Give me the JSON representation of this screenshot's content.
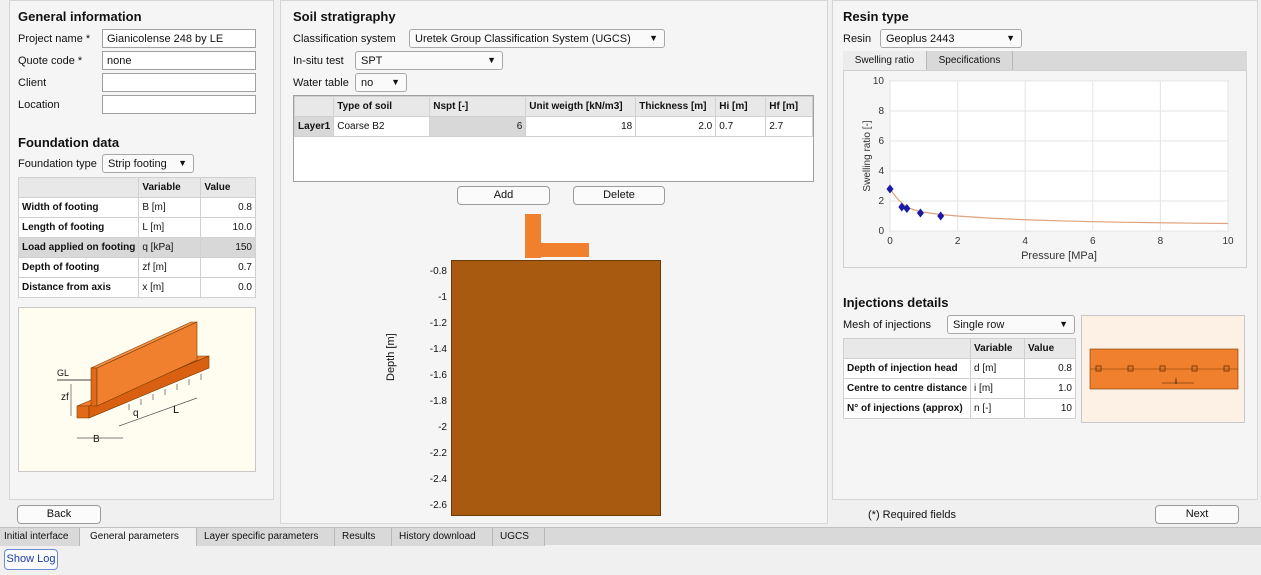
{
  "general": {
    "title": "General information",
    "project_label": "Project name *",
    "project_value": "Gianicolense 248 by LE",
    "quote_label": "Quote code *",
    "quote_value": "none",
    "client_label": "Client",
    "client_value": "",
    "location_label": "Location",
    "location_value": ""
  },
  "foundation": {
    "title": "Foundation data",
    "type_label": "Foundation type",
    "type_value": "Strip footing",
    "headers": [
      "",
      "Variable",
      "Value"
    ],
    "rows": [
      {
        "name": "Width of footing",
        "variable": "B [m]",
        "value": "0.8"
      },
      {
        "name": "Length of footing",
        "variable": "L [m]",
        "value": "10.0"
      },
      {
        "name": "Load applied on footing",
        "variable": "q [kPa]",
        "value": "150"
      },
      {
        "name": "Depth of footing",
        "variable": "zf [m]",
        "value": "0.7"
      },
      {
        "name": "Distance from axis",
        "variable": "x [m]",
        "value": "0.0"
      }
    ],
    "diagram_labels": {
      "gl": "GL",
      "zf": "zf",
      "q": "q",
      "l": "L",
      "b": "B"
    }
  },
  "soil": {
    "title": "Soil stratigraphy",
    "classification_label": "Classification system",
    "classification_value": "Uretek Group Classification System (UGCS)",
    "insitu_label": "In-situ test",
    "insitu_value": "SPT",
    "water_label": "Water table",
    "water_value": "no",
    "headers": [
      "",
      "Type of soil",
      "Nspt [-]",
      "Unit weigth [kN/m3]",
      "Thickness [m]",
      "Hi [m]",
      "Hf [m]"
    ],
    "layers": [
      {
        "layer": "Layer1",
        "type": "Coarse B2",
        "nspt": "6",
        "unit_weight": "18",
        "thickness": "2.0",
        "hi": "0.7",
        "hf": "2.7"
      }
    ],
    "add_label": "Add",
    "delete_label": "Delete",
    "depth_axis_label": "Depth [m]",
    "depth_ticks": [
      "-0.8",
      "-1",
      "-1.2",
      "-1.4",
      "-1.6",
      "-1.8",
      "-2",
      "-2.2",
      "-2.4",
      "-2.6"
    ]
  },
  "resin": {
    "title": "Resin type",
    "resin_label": "Resin",
    "resin_value": "Geoplus 2443",
    "tabs": [
      "Swelling ratio",
      "Specifications"
    ]
  },
  "chart_data": {
    "type": "scatter",
    "xlabel": "Pressure [MPa]",
    "ylabel": "Swelling ratio [-]",
    "xlim": [
      0,
      10
    ],
    "ylim": [
      0,
      10
    ],
    "xticks": [
      0,
      2,
      4,
      6,
      8,
      10
    ],
    "yticks": [
      0,
      2,
      4,
      6,
      8,
      10
    ],
    "grid": true,
    "points": {
      "x": [
        0.0,
        0.35,
        0.5,
        0.9,
        1.5
      ],
      "y": [
        2.8,
        1.6,
        1.5,
        1.2,
        1.0
      ]
    },
    "curve": {
      "x": [
        0.0,
        0.2,
        0.4,
        0.6,
        0.8,
        1.0,
        1.5,
        2.0,
        3.0,
        4.0,
        5.0,
        6.0,
        7.0,
        8.0,
        9.0,
        10.0
      ],
      "y": [
        2.8,
        2.2,
        1.75,
        1.5,
        1.35,
        1.25,
        1.1,
        1.0,
        0.85,
        0.75,
        0.68,
        0.62,
        0.58,
        0.55,
        0.52,
        0.5
      ]
    },
    "colors": {
      "points": "#1a1aa6",
      "curve": "#e0a27a"
    }
  },
  "injections": {
    "title": "Injections details",
    "mesh_label": "Mesh of injections",
    "mesh_value": "Single row",
    "headers": [
      "",
      "Variable",
      "Value"
    ],
    "rows": [
      {
        "name": "Depth of injection head",
        "variable": "d [m]",
        "value": "0.8"
      },
      {
        "name": "Centre to centre distance",
        "variable": "i [m]",
        "value": "1.0"
      },
      {
        "name": "N° of injections (approx)",
        "variable": "n [-]",
        "value": "10"
      }
    ],
    "diagram_label": "i"
  },
  "nav": {
    "back_label": "Back",
    "next_label": "Next",
    "required_note": "(*) Required fields",
    "show_log_label": "Show Log"
  },
  "tabs": [
    "Initial interface",
    "General parameters",
    "Layer specific parameters",
    "Results",
    "History download",
    "UGCS"
  ],
  "colors": {
    "footing": "#f0802e",
    "soil": "#a85a10",
    "panel_bg": "#f5f5f5"
  }
}
